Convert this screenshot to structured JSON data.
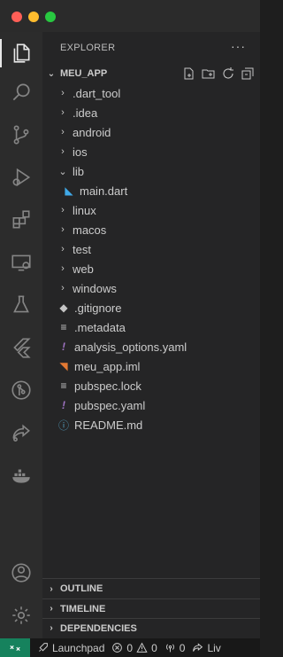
{
  "explorer": {
    "title": "EXPLORER",
    "more": "···",
    "project": "MEU_APP"
  },
  "tree": [
    {
      "label": ".dart_tool",
      "type": "folder",
      "depth": 1,
      "expanded": false
    },
    {
      "label": ".idea",
      "type": "folder",
      "depth": 1,
      "expanded": false
    },
    {
      "label": "android",
      "type": "folder",
      "depth": 1,
      "expanded": false
    },
    {
      "label": "ios",
      "type": "folder",
      "depth": 1,
      "expanded": false
    },
    {
      "label": "lib",
      "type": "folder",
      "depth": 1,
      "expanded": true
    },
    {
      "label": "main.dart",
      "type": "dart",
      "depth": 2
    },
    {
      "label": "linux",
      "type": "folder",
      "depth": 1,
      "expanded": false
    },
    {
      "label": "macos",
      "type": "folder",
      "depth": 1,
      "expanded": false
    },
    {
      "label": "test",
      "type": "folder",
      "depth": 1,
      "expanded": false
    },
    {
      "label": "web",
      "type": "folder",
      "depth": 1,
      "expanded": false
    },
    {
      "label": "windows",
      "type": "folder",
      "depth": 1,
      "expanded": false
    },
    {
      "label": ".gitignore",
      "type": "git",
      "depth": 1
    },
    {
      "label": ".metadata",
      "type": "lines",
      "depth": 1
    },
    {
      "label": "analysis_options.yaml",
      "type": "yaml",
      "depth": 1
    },
    {
      "label": "meu_app.iml",
      "type": "rss",
      "depth": 1
    },
    {
      "label": "pubspec.lock",
      "type": "lines",
      "depth": 1
    },
    {
      "label": "pubspec.yaml",
      "type": "yaml",
      "depth": 1
    },
    {
      "label": "README.md",
      "type": "info",
      "depth": 1
    }
  ],
  "sections": {
    "outline": "OUTLINE",
    "timeline": "TIMELINE",
    "dependencies": "DEPENDENCIES"
  },
  "status": {
    "launchpad": "Launchpad",
    "errors": "0",
    "warnings": "0",
    "ports": "0",
    "live": "Liv"
  },
  "colors": {
    "remote": "#16825d",
    "dart": "#40a9e8",
    "yaml": "#a074c4",
    "rss": "#e37933",
    "info": "#519aba"
  }
}
